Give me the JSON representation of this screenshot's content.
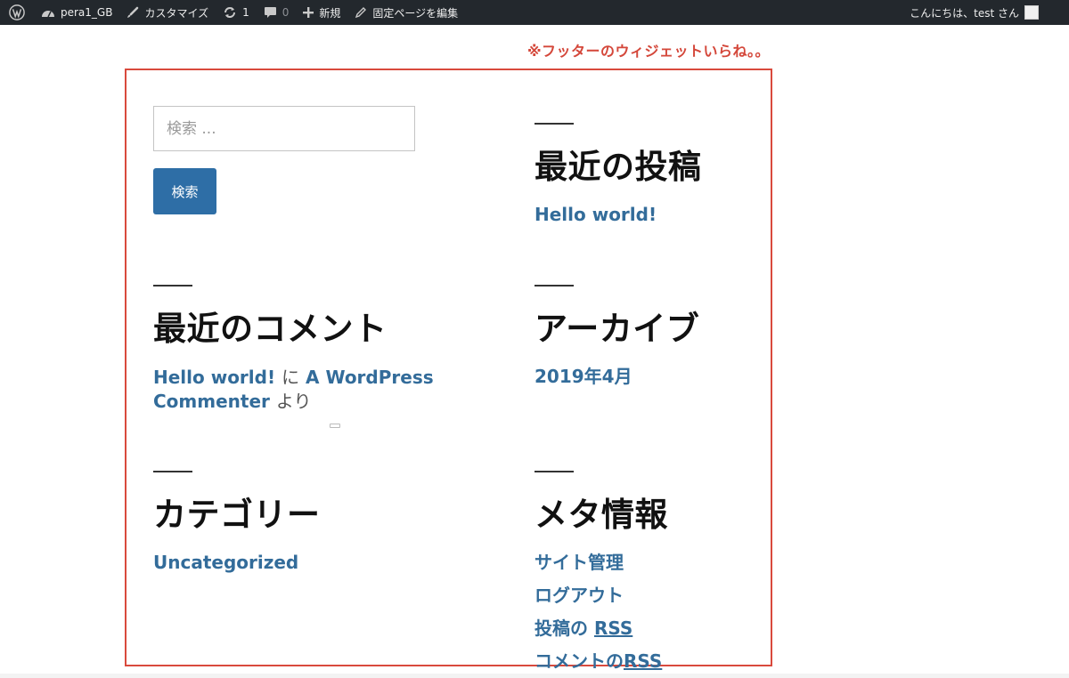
{
  "adminbar": {
    "site_name": "pera1_GB",
    "customize": "カスタマイズ",
    "updates_count": "1",
    "comments_count": "0",
    "new_label": "新規",
    "edit_page": "固定ページを編集",
    "greeting": "こんにちは、test さん",
    "bg_color": "#23282d"
  },
  "annotation": {
    "text": "※フッターのウィジェットいらね。。",
    "color": "#d4473a"
  },
  "search": {
    "placeholder": "検索 ...",
    "button_label": "検索"
  },
  "recent_posts": {
    "title": "最近の投稿",
    "items": [
      "Hello world!"
    ]
  },
  "recent_comments": {
    "title": "最近のコメント",
    "post_link": "Hello world!",
    "connector": "に",
    "author_link_1": "A WordPress",
    "author_link_2": "Commenter",
    "suffix": "より"
  },
  "archives": {
    "title": "アーカイブ",
    "items": [
      "2019年4月"
    ]
  },
  "categories": {
    "title": "カテゴリー",
    "items": [
      "Uncategorized"
    ]
  },
  "meta": {
    "title": "メタ情報",
    "site_admin": "サイト管理",
    "logout": "ログアウト",
    "posts_rss_prefix": "投稿の",
    "comments_rss_prefix": "コメントの",
    "rss": "RSS"
  },
  "colors": {
    "link": "#336c9a",
    "button": "#2e6ea6",
    "highlight_box": "#d94a3d"
  }
}
